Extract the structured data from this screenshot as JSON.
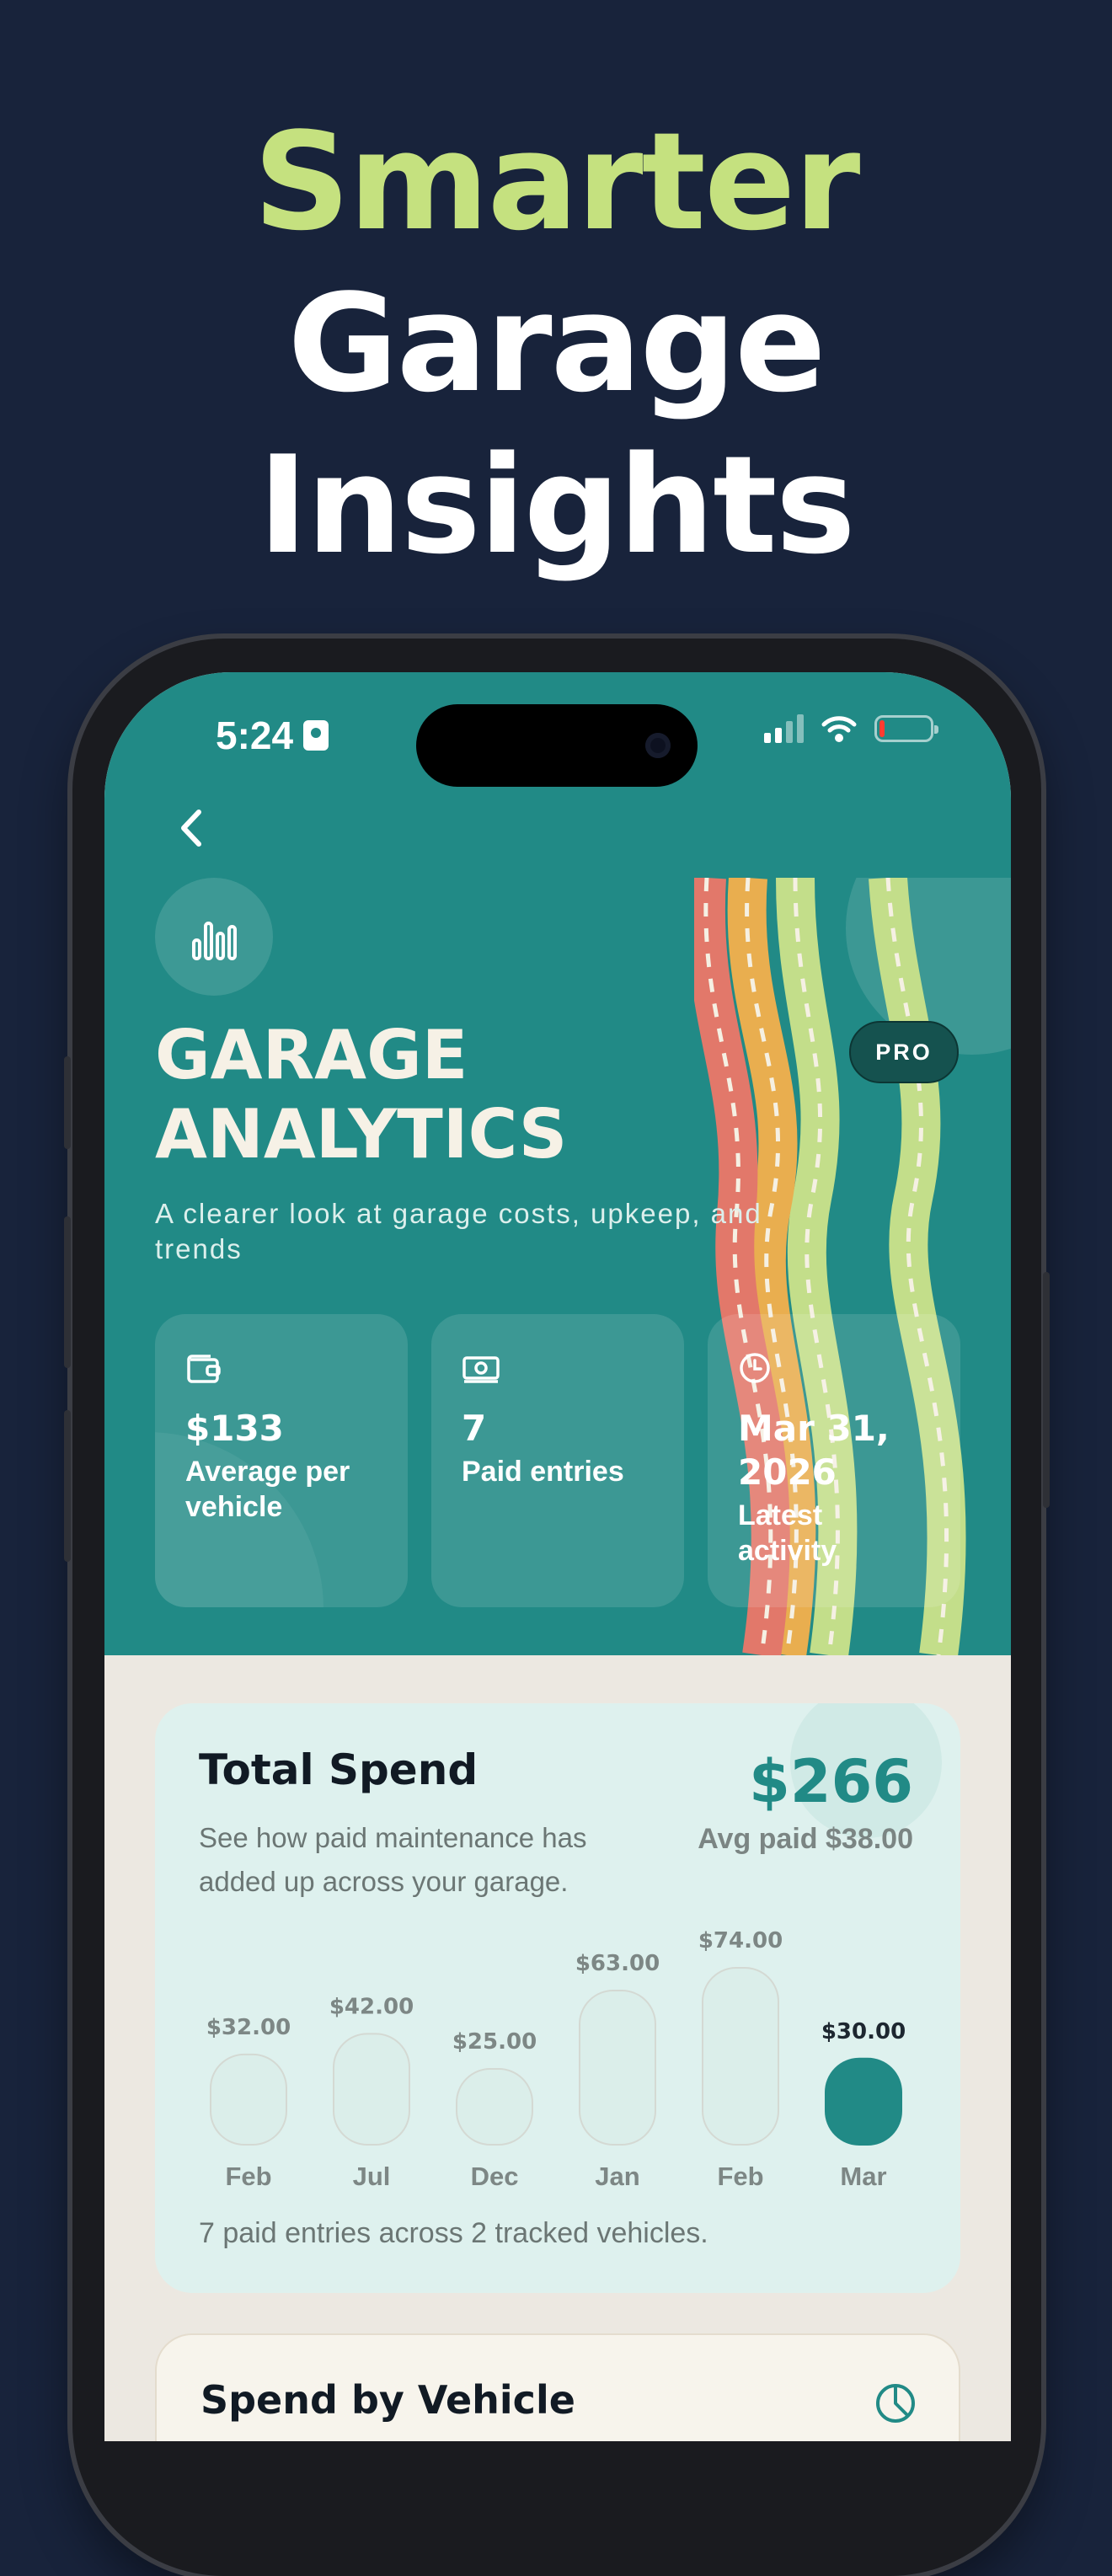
{
  "marketing": {
    "headline_line1": "Smarter",
    "headline_line2": "Garage",
    "headline_line3": "Insights"
  },
  "status_bar": {
    "time": "5:24",
    "battery_level": 0.1
  },
  "header": {
    "back_icon": "chevron-left-icon",
    "analytics_icon": "bar-chart-icon",
    "title_line1": "GARAGE",
    "title_line2": "ANALYTICS",
    "subtitle": "A clearer look at garage costs, upkeep, and trends",
    "badge": "PRO"
  },
  "stats": [
    {
      "icon": "wallet-icon",
      "value": "$133",
      "label": "Average per vehicle"
    },
    {
      "icon": "cash-icon",
      "value": "7",
      "label": "Paid entries"
    },
    {
      "icon": "clock-icon",
      "value": "Mar 31, 2026",
      "label": "Latest activity"
    }
  ],
  "total_spend": {
    "title": "Total Spend",
    "description": "See how paid maintenance has added up across your garage.",
    "total": "$266",
    "average": "Avg paid $38.00",
    "footer": "7 paid entries across 2 tracked vehicles."
  },
  "chart_data": {
    "type": "bar",
    "categories": [
      "Feb",
      "Jul",
      "Dec",
      "Jan",
      "Feb",
      "Mar"
    ],
    "values": [
      32,
      42,
      25,
      63,
      74,
      30
    ],
    "value_labels": [
      "$32.00",
      "$42.00",
      "$25.00",
      "$63.00",
      "$74.00",
      "$30.00"
    ],
    "highlight_index": 5,
    "title": "",
    "xlabel": "",
    "ylabel": "",
    "ylim": [
      0,
      74
    ]
  },
  "spend_by_vehicle": {
    "title": "Spend by Vehicle",
    "icon": "pie-chart-icon"
  },
  "colors": {
    "background": "#18233b",
    "accent_green": "#c5e17f",
    "teal": "#218a86",
    "highlight_bar": "#218a86",
    "road_red": "#e2786a",
    "road_orange": "#e9ae4f",
    "road_green": "#c3de8a"
  }
}
